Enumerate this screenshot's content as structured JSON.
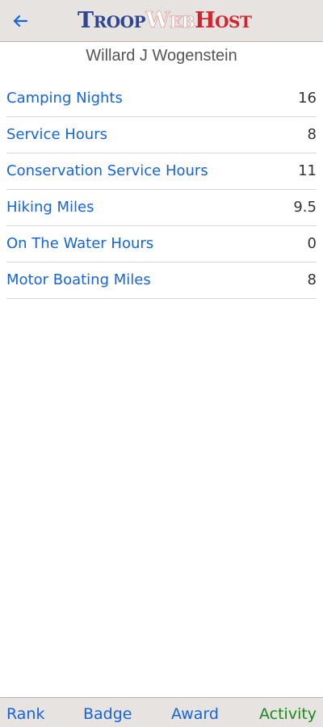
{
  "header": {
    "back_icon": "arrow-left-icon",
    "logo": {
      "troop_initial": "T",
      "troop_rest": "ROOP",
      "web_initial": "W",
      "web_rest": "EB",
      "host_initial": "H",
      "host_rest": "OST"
    }
  },
  "member": {
    "name": "Willard J Wogenstein"
  },
  "activities": [
    {
      "label": "Camping Nights",
      "value": "16"
    },
    {
      "label": "Service Hours",
      "value": "8"
    },
    {
      "label": "Conservation Service Hours",
      "value": "11"
    },
    {
      "label": "Hiking Miles",
      "value": "9.5"
    },
    {
      "label": "On The Water Hours",
      "value": "0"
    },
    {
      "label": "Motor Boating Miles",
      "value": "8"
    }
  ],
  "tabs": [
    {
      "label": "Rank",
      "active": false
    },
    {
      "label": "Badge",
      "active": false
    },
    {
      "label": "Award",
      "active": false
    },
    {
      "label": "Activity",
      "active": true
    }
  ],
  "colors": {
    "link_blue": "#1565d8",
    "active_green": "#1b8a1b",
    "bar_background": "#e6e3e1",
    "logo_blue": "#2e4591",
    "logo_red": "#d1242f"
  }
}
